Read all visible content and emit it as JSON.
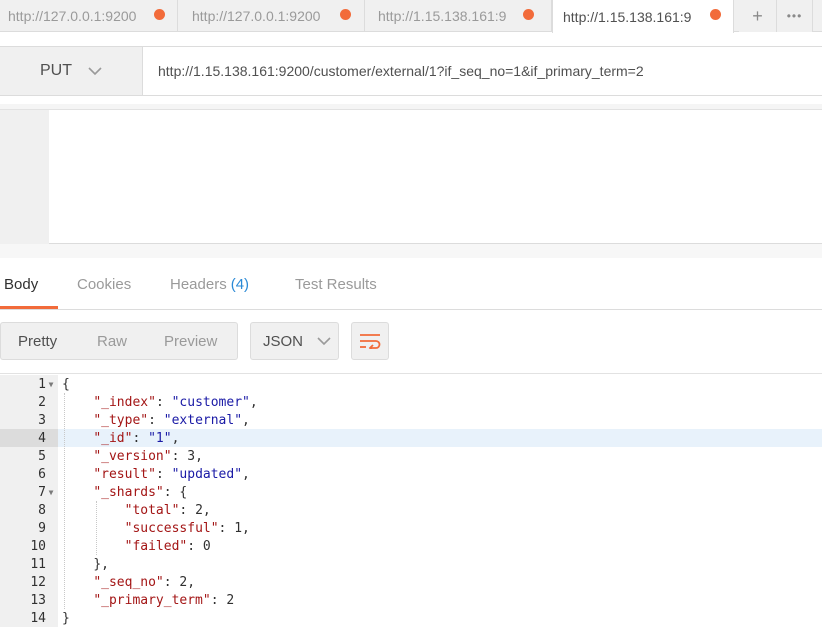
{
  "tabs": [
    {
      "label": "http://127.0.0.1:9200",
      "active": false
    },
    {
      "label": "http://127.0.0.1:9200",
      "active": false
    },
    {
      "label": "http://1.15.138.161:9",
      "active": false
    },
    {
      "label": "http://1.15.138.161:9",
      "active": true
    }
  ],
  "tab_controls": {
    "add": "+",
    "more": "•••"
  },
  "request": {
    "method": "PUT",
    "url": "http://1.15.138.161:9200/customer/external/1?if_seq_no=1&if_primary_term=2"
  },
  "response_tabs": {
    "body": "Body",
    "cookies": "Cookies",
    "headers": "Headers",
    "headers_count": "(4)",
    "tests": "Test Results"
  },
  "view_modes": {
    "pretty": "Pretty",
    "raw": "Raw",
    "preview": "Preview"
  },
  "format": "JSON",
  "colors": {
    "accent": "#f26b3a",
    "badge": "#2b8ad6"
  },
  "code": {
    "highlighted_line": 4,
    "lines": [
      {
        "n": "1",
        "fold": true,
        "indent": 0,
        "key": "",
        "value": "",
        "text": "{"
      },
      {
        "n": "2",
        "fold": false,
        "indent": 1,
        "key": "\"_index\"",
        "value": "\"customer\"",
        "tail": ","
      },
      {
        "n": "3",
        "fold": false,
        "indent": 1,
        "key": "\"_type\"",
        "value": "\"external\"",
        "tail": ","
      },
      {
        "n": "4",
        "fold": false,
        "indent": 1,
        "key": "\"_id\"",
        "value": "\"1\"",
        "tail": ","
      },
      {
        "n": "5",
        "fold": false,
        "indent": 1,
        "key": "\"_version\"",
        "value": "3",
        "tail": ","
      },
      {
        "n": "6",
        "fold": false,
        "indent": 1,
        "key": "\"result\"",
        "value": "\"updated\"",
        "tail": ","
      },
      {
        "n": "7",
        "fold": true,
        "indent": 1,
        "key": "\"_shards\"",
        "value": "{",
        "tail": ""
      },
      {
        "n": "8",
        "fold": false,
        "indent": 2,
        "key": "\"total\"",
        "value": "2",
        "tail": ","
      },
      {
        "n": "9",
        "fold": false,
        "indent": 2,
        "key": "\"successful\"",
        "value": "1",
        "tail": ","
      },
      {
        "n": "10",
        "fold": false,
        "indent": 2,
        "key": "\"failed\"",
        "value": "0",
        "tail": ""
      },
      {
        "n": "11",
        "fold": false,
        "indent": 1,
        "key": "",
        "value": "",
        "text": "},"
      },
      {
        "n": "12",
        "fold": false,
        "indent": 1,
        "key": "\"_seq_no\"",
        "value": "2",
        "tail": ","
      },
      {
        "n": "13",
        "fold": false,
        "indent": 1,
        "key": "\"_primary_term\"",
        "value": "2",
        "tail": ""
      },
      {
        "n": "14",
        "fold": false,
        "indent": 0,
        "key": "",
        "value": "",
        "text": "}"
      }
    ]
  }
}
